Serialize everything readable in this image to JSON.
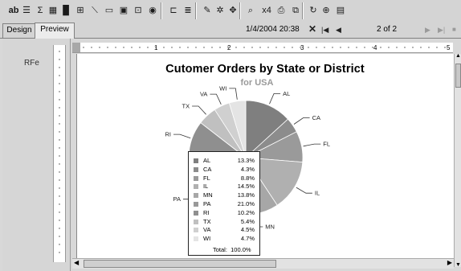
{
  "toolbar": {
    "buttons": [
      {
        "name": "textbox-tool-button",
        "icon": "ab",
        "label": "ab"
      },
      {
        "name": "field-list-button",
        "icon": "list-icon",
        "label": "☰"
      },
      {
        "name": "sum-button",
        "icon": "sigma-icon",
        "label": "Σ"
      },
      {
        "name": "table-button",
        "icon": "table-icon",
        "label": "▦"
      },
      {
        "name": "chart-button",
        "icon": "bar-chart-icon",
        "label": "▐▌"
      },
      {
        "name": "matrix-button",
        "icon": "matrix-icon",
        "label": "⊞"
      },
      {
        "name": "line-tool-button",
        "icon": "line-icon",
        "label": "⟍"
      },
      {
        "name": "rectangle-tool-button",
        "icon": "rectangle-icon",
        "label": "▭"
      },
      {
        "name": "image-tool-button",
        "icon": "image-icon",
        "label": "▣"
      },
      {
        "name": "subreport-button",
        "icon": "subreport-icon",
        "label": "⊡"
      },
      {
        "name": "globe-button",
        "icon": "globe-icon",
        "label": "◉"
      },
      {
        "name": "group-button",
        "icon": "group-icon",
        "label": "⊏"
      },
      {
        "name": "align-button",
        "icon": "align-icon",
        "label": "≣"
      },
      {
        "name": "paint-button",
        "icon": "brush-icon",
        "label": "✎"
      },
      {
        "name": "style-button",
        "icon": "palette-icon",
        "label": "✲"
      },
      {
        "name": "properties-button",
        "icon": "properties-icon",
        "label": "✥"
      },
      {
        "name": "find-button",
        "icon": "find-icon",
        "label": "⌕"
      },
      {
        "name": "export-button",
        "icon": "export-icon",
        "label": "x4"
      },
      {
        "name": "print-setup-button",
        "icon": "print-icon",
        "label": "⎙"
      },
      {
        "name": "preview-button",
        "icon": "preview-icon",
        "label": "⧉"
      },
      {
        "name": "refresh-button",
        "icon": "refresh-icon",
        "label": "↻"
      },
      {
        "name": "zoom-button",
        "icon": "zoom-icon",
        "label": "⊕"
      },
      {
        "name": "layout-button",
        "icon": "layout-icon",
        "label": "▤"
      }
    ]
  },
  "tabs": [
    {
      "label": "Design",
      "active": false
    },
    {
      "label": "Preview",
      "active": true
    }
  ],
  "preview_nav": {
    "timestamp": "1/4/2004 20:38",
    "close_icon": "close-icon",
    "close_label": "✕",
    "first_label": "|◀",
    "prev_label": "◀",
    "page_indicator": "2 of 2",
    "next_label": "▶",
    "last_label": "▶|",
    "stop_label": "■"
  },
  "left_panel": {
    "label": "RFe"
  },
  "ruler": {
    "numbers": [
      "1",
      "2",
      "3",
      "4",
      "5"
    ]
  },
  "chart_data": {
    "type": "pie",
    "title": "Cutomer Orders by State or District",
    "subtitle": "for USA",
    "categories": [
      "AL",
      "CA",
      "FL",
      "IL",
      "MN",
      "PA",
      "RI",
      "TX",
      "VA",
      "WI"
    ],
    "values": [
      13.3,
      4.3,
      8.8,
      14.5,
      13.8,
      21.0,
      10.2,
      5.4,
      4.5,
      4.7
    ],
    "value_labels": [
      "13.3%",
      "4.3%",
      "8.8%",
      "14.5%",
      "13.8%",
      "21.0%",
      "10.2%",
      "5.4%",
      "4.5%",
      "4.7%"
    ],
    "colors": [
      "#7f7f7f",
      "#8c8c8c",
      "#9a9a9a",
      "#b0b0b0",
      "#a7a7a7",
      "#999999",
      "#8f8f8f",
      "#c0c0c0",
      "#d0d0d0",
      "#e4e4e4"
    ],
    "legend": {
      "total_label": "Total:",
      "total_value": "100.0%",
      "placement": "center"
    }
  }
}
